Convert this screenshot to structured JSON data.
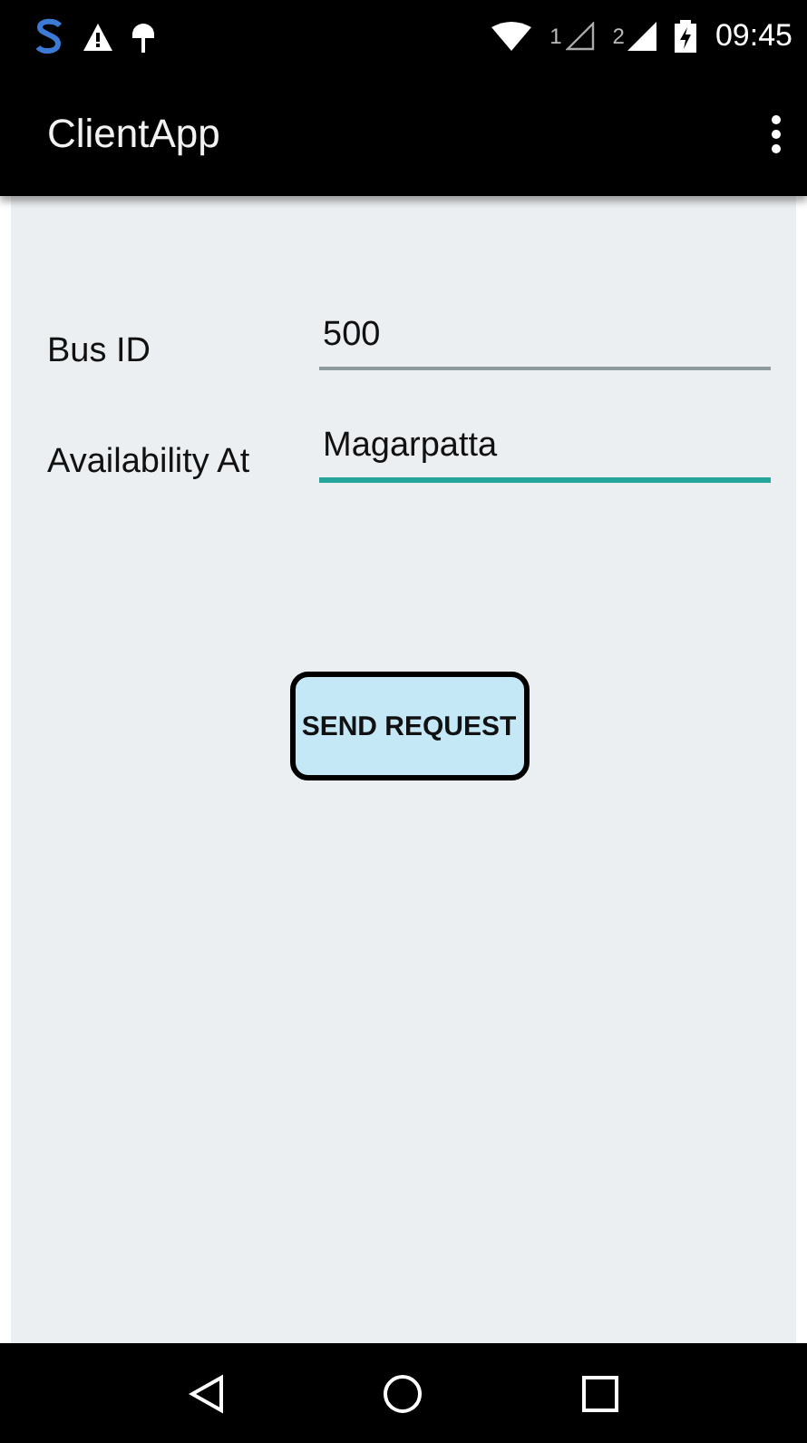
{
  "status_bar": {
    "sim_labels": [
      "1",
      "2"
    ],
    "time": "09:45"
  },
  "app_bar": {
    "title": "ClientApp"
  },
  "form": {
    "fields": [
      {
        "label": "Bus ID",
        "value": "500",
        "focused": false
      },
      {
        "label": "Availability At",
        "value": "Magarpatta",
        "focused": true
      }
    ]
  },
  "button": {
    "label": "SEND REQUEST"
  }
}
